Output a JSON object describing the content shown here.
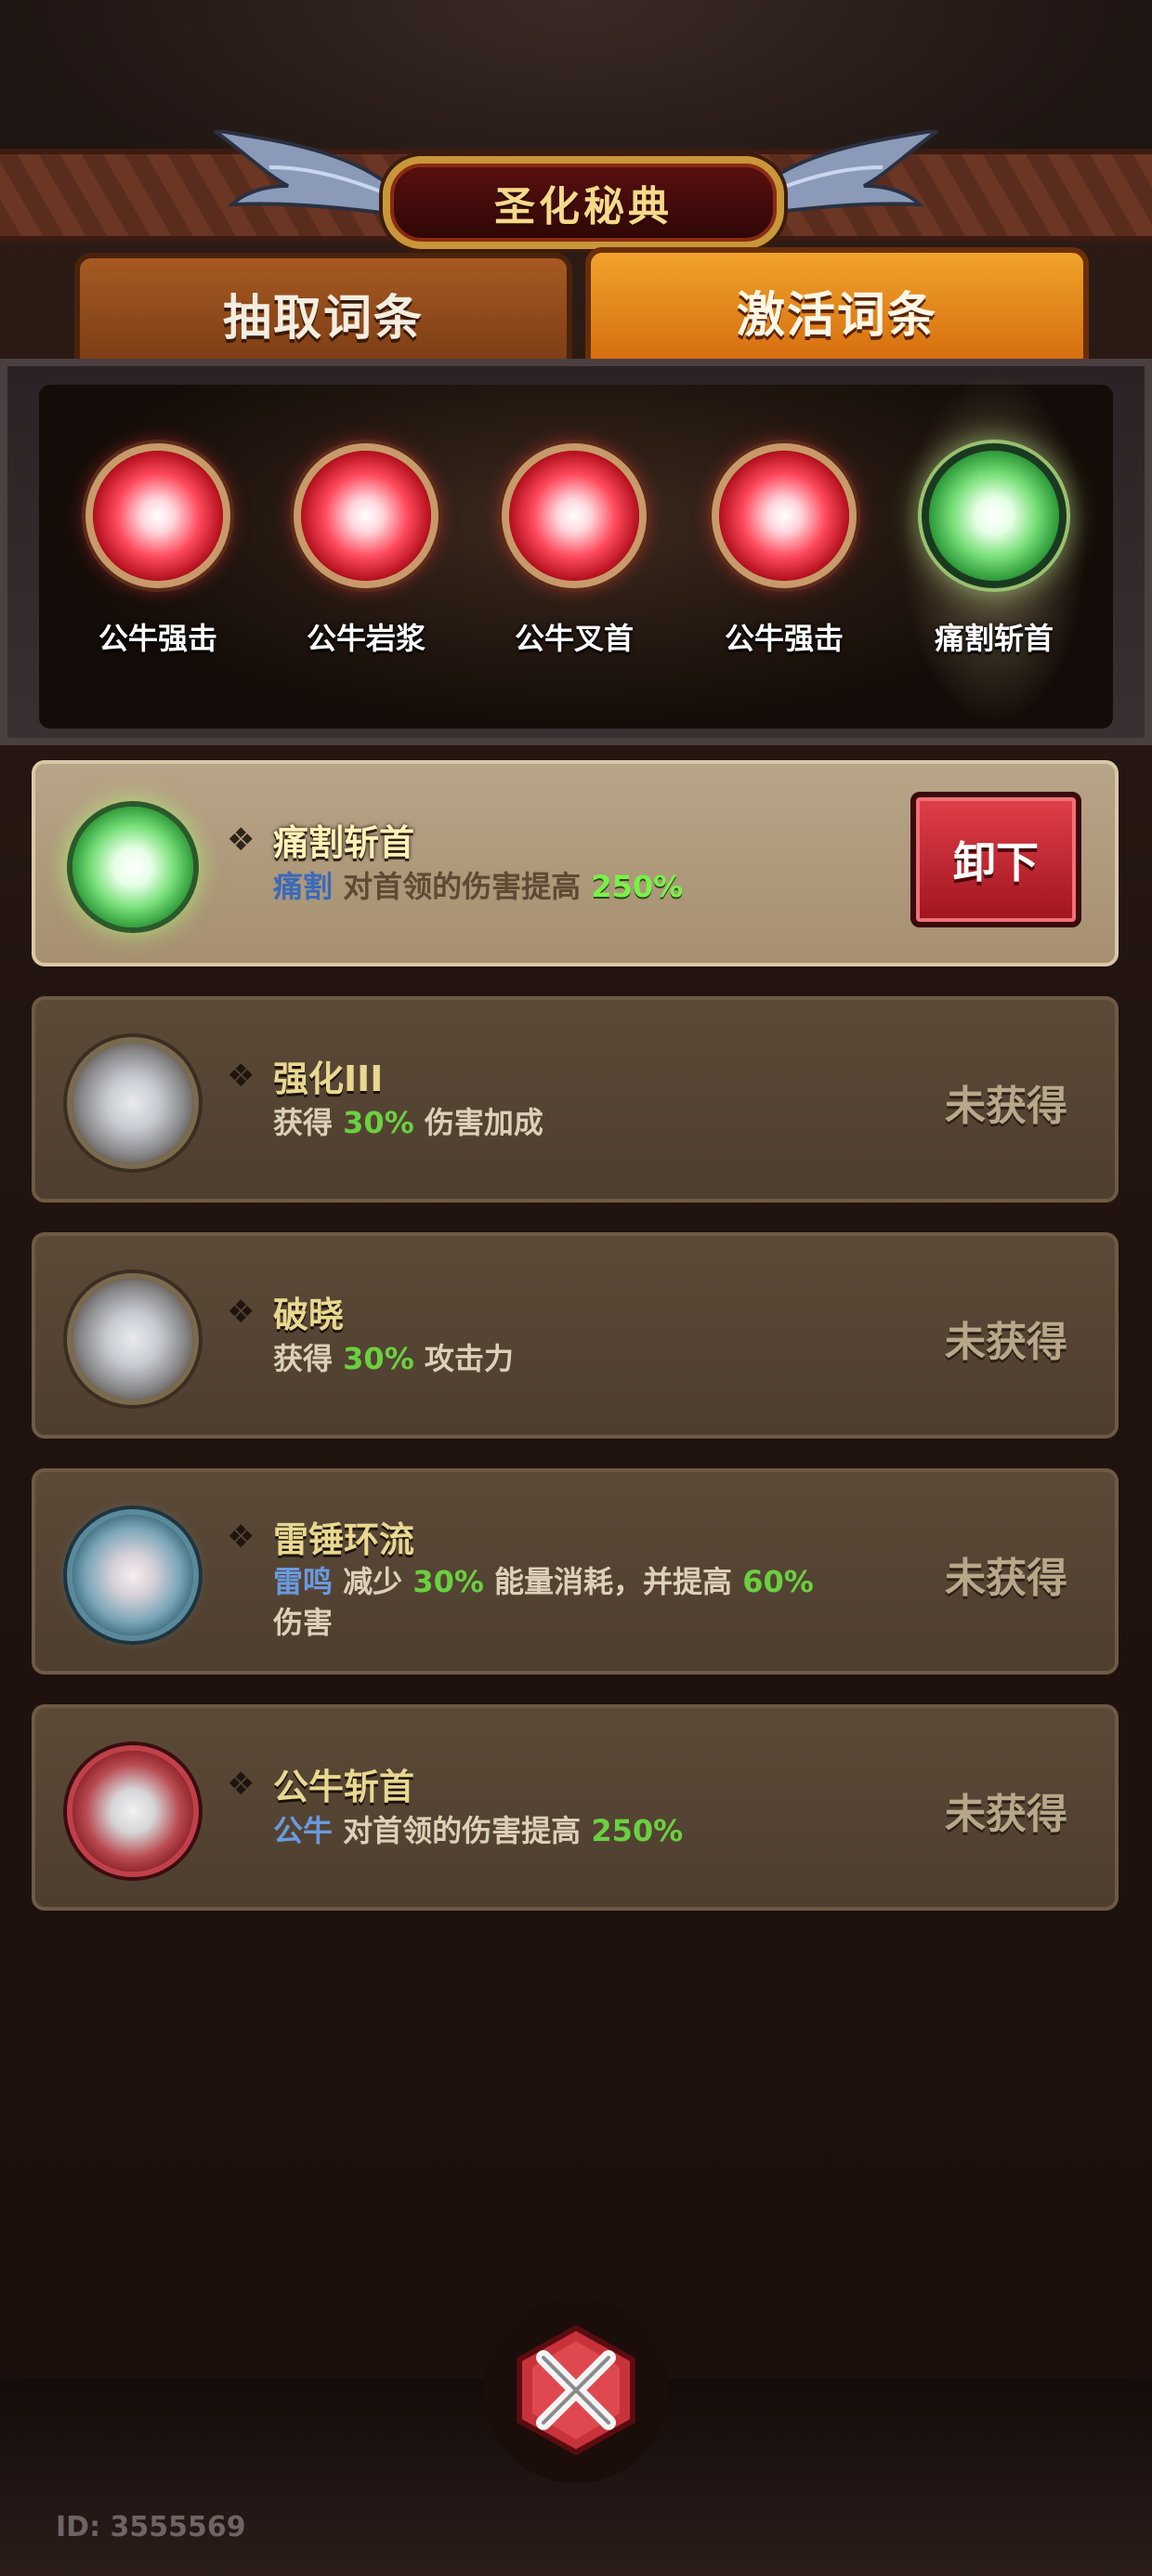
{
  "header": {
    "title": "圣化秘典"
  },
  "tabs": [
    {
      "label": "抽取词条",
      "active": false
    },
    {
      "label": "激活词条",
      "active": true
    }
  ],
  "slots": [
    {
      "label": "公牛强击",
      "orb_color": "red"
    },
    {
      "label": "公牛岩浆",
      "orb_color": "red"
    },
    {
      "label": "公牛叉首",
      "orb_color": "red"
    },
    {
      "label": "公牛强击",
      "orb_color": "red"
    },
    {
      "label": "痛割斩首",
      "orb_color": "green",
      "highlighted": true
    }
  ],
  "cards": [
    {
      "name": "痛割斩首",
      "orb_color": "green",
      "state": "equipped",
      "desc_prefix": "痛割",
      "desc_mid": "对首领的伤害提高",
      "desc_value": "250%",
      "action_label": "卸下"
    },
    {
      "name": "强化III",
      "orb_color": "gray",
      "state": "locked",
      "desc_prefix": "获得",
      "desc_value": "30%",
      "desc_suffix": "伤害加成",
      "status_label": "未获得"
    },
    {
      "name": "破晓",
      "orb_color": "gray",
      "state": "locked",
      "desc_prefix": "获得",
      "desc_value": "30%",
      "desc_suffix": "攻击力",
      "status_label": "未获得"
    },
    {
      "name": "雷锤环流",
      "orb_color": "blue",
      "state": "locked",
      "desc_tag": "雷鸣",
      "desc_mid": "减少",
      "desc_value": "30%",
      "desc_mid2": "能量消耗，并提高",
      "desc_value2": "60%",
      "desc_suffix": "伤害",
      "status_label": "未获得"
    },
    {
      "name": "公牛斩首",
      "orb_color": "red",
      "state": "locked",
      "desc_tag": "公牛",
      "desc_mid": "对首领的伤害提高",
      "desc_value": "250%",
      "status_label": "未获得"
    }
  ],
  "bullet_glyph": "❖",
  "footer": {
    "player_id": "ID: 3555569"
  },
  "colors": {
    "accent_orange": "#d46a0e",
    "unequip_red": "#c02a34",
    "highlight_green": "#6ee040",
    "tag_blue": "#3a6ab8"
  }
}
